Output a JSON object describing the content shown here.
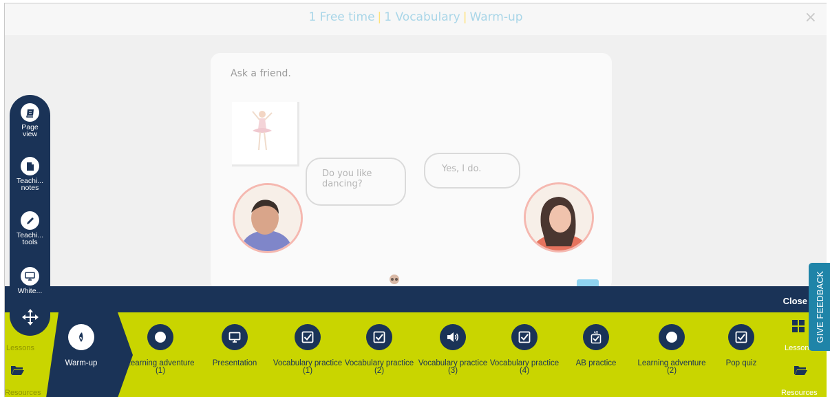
{
  "header": {
    "title_parts": [
      "1 Free time",
      "1 Vocabulary",
      "Warm-up"
    ],
    "separator": "|",
    "close_glyph": "×"
  },
  "activity": {
    "prompt": "Ask a friend.",
    "bubble_question": "Do you like dancing?",
    "bubble_answer": "Yes, I do."
  },
  "lesson_bar": {
    "close_label": "Close"
  },
  "left_nav": {
    "lessons_label": "Lessons",
    "resources_label": "Resources"
  },
  "right_nav": {
    "lessons_label": "Lessons",
    "resources_label": "Resources"
  },
  "activities": [
    {
      "label": "Warm-up",
      "icon": "warmup-icon",
      "active": true
    },
    {
      "label": "Learning adventure\n(1)",
      "icon": "circle-icon"
    },
    {
      "label": "Presentation",
      "icon": "monitor-icon"
    },
    {
      "label": "Vocabulary practice\n(1)",
      "icon": "checkbox-icon"
    },
    {
      "label": "Vocabulary practice\n(2)",
      "icon": "checkbox-icon"
    },
    {
      "label": "Vocabulary practice\n(3)",
      "icon": "speaker-icon"
    },
    {
      "label": "Vocabulary practice\n(4)",
      "icon": "checkbox-icon"
    },
    {
      "label": "AB practice",
      "icon": "ab-checkbox-icon"
    },
    {
      "label": "Learning adventure\n(2)",
      "icon": "circle-icon"
    },
    {
      "label": "Pop quiz",
      "icon": "checkbox-icon"
    }
  ],
  "tools": [
    {
      "label": "Page\nview",
      "icon": "book-icon"
    },
    {
      "label": "Teachi...\nnotes",
      "icon": "document-icon"
    },
    {
      "label": "Teachi...\ntools",
      "icon": "pencil-icon"
    },
    {
      "label": "White...",
      "icon": "monitor-icon"
    }
  ],
  "feedback_label": "GIVE FEEDBACK",
  "colors": {
    "navy": "#1a3357",
    "lime": "#c9d500",
    "feedback": "#1f84a8",
    "title_blue": "#a9d6e8",
    "title_separator": "#ffe27a"
  }
}
